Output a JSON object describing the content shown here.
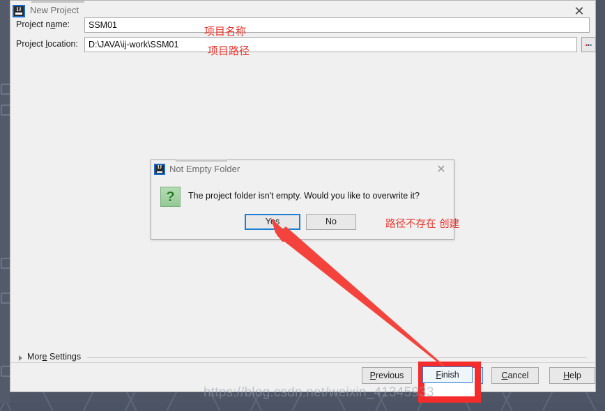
{
  "backdrop": {
    "glyph_rows": [
      "╳ ╲ ╱ ╳ ╱ ╲ ╳ ╱ ╲ ╳ ╱ ╲ ╳ ╱ ╲ ╳ ╱ ╲ ╳ ╱"
    ]
  },
  "window": {
    "title": "New Project",
    "icon": "intellij-idea-icon",
    "ij_text": "IJ",
    "close_label": "✕"
  },
  "form": {
    "project_name": {
      "label_before": "Project n",
      "label_accel": "a",
      "label_after": "me:",
      "value": "SSM01",
      "placeholder": "Project name"
    },
    "project_location": {
      "label_before": "Project ",
      "label_accel": "l",
      "label_after": "ocation:",
      "value": "D:\\JAVA\\ij-work\\SSM01",
      "placeholder": "Project location"
    },
    "browse_button": {
      "name": "browse-ellipsis-button",
      "dots": [
        ".",
        ".",
        "."
      ]
    }
  },
  "annotations": {
    "project_name_note": "项目名称",
    "project_path_note": "项目路径",
    "create_path_note": "路径不存在 创建",
    "accent_color": "#e8352d",
    "highlight_color": "#f42c2c"
  },
  "more_settings": {
    "label_before": "Mor",
    "label_accel": "e",
    "label_after": " Settings"
  },
  "footer_buttons": [
    {
      "name": "previous-button",
      "before": "",
      "accel": "P",
      "after": "revious"
    },
    {
      "name": "finish-button",
      "before": "",
      "accel": "F",
      "after": "inish"
    },
    {
      "name": "cancel-button",
      "before": "",
      "accel": "C",
      "after": "ancel"
    },
    {
      "name": "help-button",
      "before": "",
      "accel": "H",
      "after": "elp"
    }
  ],
  "modal": {
    "title": "Not Empty Folder",
    "icon": "intellij-idea-icon",
    "ij_text": "IJ",
    "close_label": "✕",
    "question_glyph": "?",
    "message": "The project folder isn't empty. Would you like to overwrite it?",
    "yes_label": "Yes",
    "no_label": "No",
    "focused_button": "Yes",
    "focus_color": "#1b7fd4"
  },
  "watermark": {
    "text": "https://blog.csdn.net/weixin_41345933"
  }
}
